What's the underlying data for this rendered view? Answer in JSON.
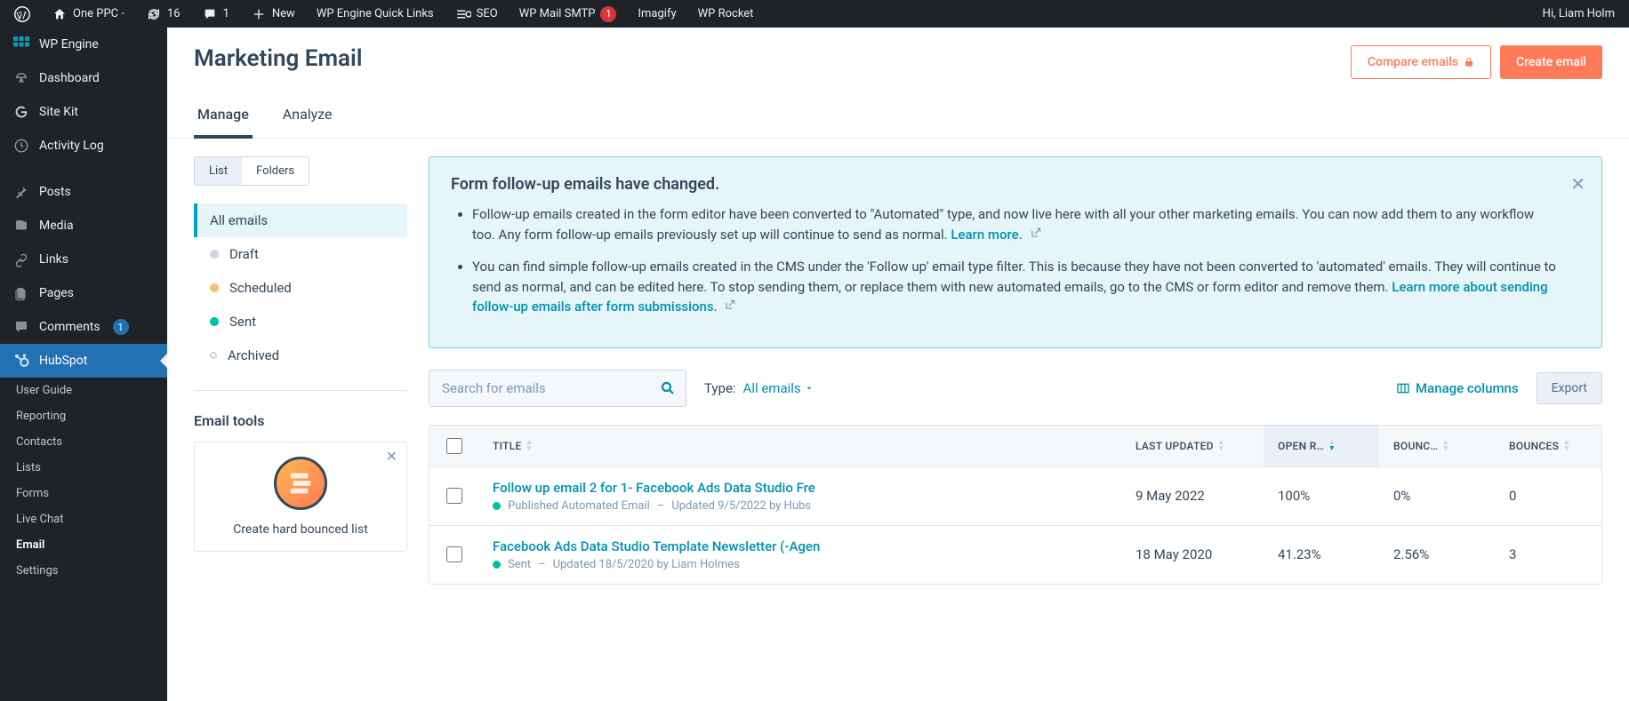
{
  "admin_bar": {
    "site_name": "One PPC -",
    "updates": "16",
    "comments": "1",
    "new": "New",
    "quick_links": "WP Engine Quick Links",
    "seo": "SEO",
    "smtp": "WP Mail SMTP",
    "smtp_badge": "1",
    "imagify": "Imagify",
    "rocket": "WP Rocket",
    "greeting": "Hi, Liam Holm"
  },
  "sidebar": {
    "wpengine": "WP Engine",
    "dashboard": "Dashboard",
    "sitekit": "Site Kit",
    "activity": "Activity Log",
    "posts": "Posts",
    "media": "Media",
    "links": "Links",
    "pages": "Pages",
    "comments": "Comments",
    "comments_badge": "1",
    "hubspot": "HubSpot",
    "sub": {
      "user_guide": "User Guide",
      "reporting": "Reporting",
      "contacts": "Contacts",
      "lists": "Lists",
      "forms": "Forms",
      "live_chat": "Live Chat",
      "email": "Email",
      "settings": "Settings"
    }
  },
  "page": {
    "title": "Marketing Email",
    "compare_btn": "Compare emails",
    "create_btn": "Create email",
    "tabs": {
      "manage": "Manage",
      "analyze": "Analyze"
    }
  },
  "left_panel": {
    "toggle": {
      "list": "List",
      "folders": "Folders"
    },
    "filters": {
      "all": "All emails",
      "draft": "Draft",
      "scheduled": "Scheduled",
      "sent": "Sent",
      "archived": "Archived"
    },
    "tools_title": "Email tools",
    "tool_card": "Create hard bounced list"
  },
  "notice": {
    "title": "Form follow-up emails have changed.",
    "bullet1_pre": "Follow-up emails created in the form editor have been converted to \"Automated\" type, and now live here with all your other marketing emails. You can now add them to any workflow too. Any form follow-up emails previously set up will continue to send as normal. ",
    "bullet1_link": "Learn more.",
    "bullet2_pre": "You can find simple follow-up emails created in the CMS under the 'Follow up' email type filter. This is because they have not been converted to 'automated' emails. They will continue to send as normal, and can be edited here. To stop sending them, or replace them with new automated emails, go to the CMS or form editor and remove them. ",
    "bullet2_link": "Learn more about sending follow-up emails after form submissions."
  },
  "controls": {
    "search_placeholder": "Search for emails",
    "type_label": "Type:",
    "type_value": "All emails",
    "manage_cols": "Manage columns",
    "export": "Export"
  },
  "table": {
    "headers": {
      "title": "TITLE",
      "updated": "LAST UPDATED",
      "open": "OPEN R…",
      "bounce_rate": "BOUNC…",
      "bounces": "BOUNCES"
    },
    "rows": [
      {
        "title": "Follow up email 2 for 1- Facebook Ads Data Studio Fre",
        "status": "Published Automated Email",
        "meta_sep": "–",
        "meta": "Updated 9/5/2022 by Hubs",
        "updated": "9 May 2022",
        "open": "100%",
        "bounce_rate": "0%",
        "bounces": "0"
      },
      {
        "title": "Facebook Ads Data Studio Template Newsletter (-Agen",
        "status": "Sent",
        "meta_sep": "–",
        "meta": "Updated 18/5/2020 by Liam Holmes",
        "updated": "18 May 2020",
        "open": "41.23%",
        "bounce_rate": "2.56%",
        "bounces": "3"
      }
    ]
  }
}
